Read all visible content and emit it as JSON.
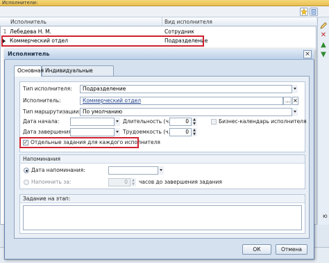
{
  "bg": {
    "title": "Исполнители:",
    "columns": [
      "Исполнитель",
      "Вид исполнителя"
    ],
    "rows": [
      {
        "num": "1",
        "name": "Лебедева Н. М.",
        "kind": "Сотрудник"
      },
      {
        "num": "",
        "name": "Коммерческий отдел",
        "kind": "Подразделение"
      }
    ],
    "side_partial_text": "ю"
  },
  "dialog": {
    "title": "Исполнитель",
    "close_label": "×",
    "tabs": [
      "Основная",
      "Индивидуальные настройки"
    ],
    "form": {
      "performer_type_label": "Тип исполнителя:",
      "performer_type_value": "Подразделение",
      "performer_label": "Исполнитель:",
      "performer_value": "Коммерческий отдел",
      "performer_more": "...",
      "routing_type_label": "Тип маршрутизации:",
      "routing_type_value": "По умолчанию",
      "start_date_label": "Дата начала:",
      "duration_label": "Длительность (ч.):",
      "duration_value": "0",
      "business_calendar_label": "Бизнес-календарь исполнителя",
      "end_date_label": "Дата завершения:",
      "labor_label": "Трудоемкость (ч.):",
      "labor_value": "0",
      "separate_tasks_label": "Отдельные задания для каждого исполнителя",
      "separate_tasks_checked": "✓"
    },
    "reminders": {
      "header": "Напоминания",
      "reminder_date_label": "Дата напоминания:",
      "remind_in_label": "Напомнить за:",
      "remind_in_value": "0",
      "remind_in_suffix": "часов до завершения задания"
    },
    "task_stage": {
      "header": "Задание на этап:"
    },
    "buttons": {
      "ok": "ОК",
      "cancel": "Отмена"
    }
  },
  "colors": {
    "highlight": "#cf2230",
    "titlebar": "#e9bf4f",
    "dialog_bg": "#d5e1ef"
  }
}
